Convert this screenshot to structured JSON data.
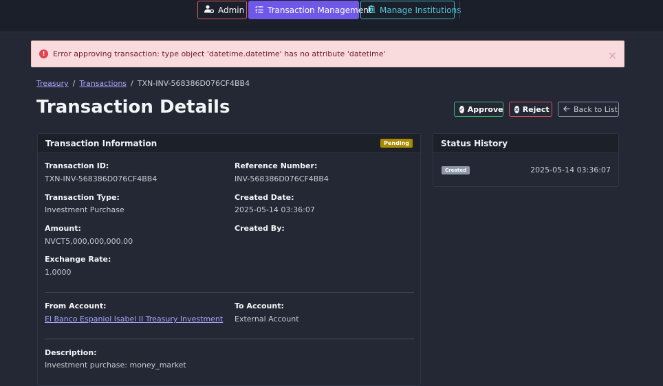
{
  "nav": {
    "admin_label": "Admin",
    "transaction_label": "Transaction Management",
    "institutions_label": "Manage Institutions"
  },
  "alert": {
    "message": "Error approving transaction: type object 'datetime.datetime' has no attribute 'datetime'",
    "icon": "exclamation-circle-icon",
    "close_glyph": "×"
  },
  "breadcrumb": {
    "items": [
      "Treasury",
      "Transactions",
      "TXN-INV-568386D076CF4BB4"
    ],
    "separator": "/"
  },
  "page": {
    "title": "Transaction Details"
  },
  "actions": {
    "approve_label": "Approve",
    "reject_label": "Reject",
    "back_label": "Back to List"
  },
  "info": {
    "header": "Transaction Information",
    "status_badge": "Pending",
    "transaction_id_label": "Transaction ID:",
    "transaction_id": "TXN-INV-568386D076CF4BB4",
    "reference_label": "Reference Number:",
    "reference": "INV-568386D076CF4BB4",
    "type_label": "Transaction Type:",
    "type": "Investment Purchase",
    "created_date_label": "Created Date:",
    "created_date": "2025-05-14 03:36:07",
    "amount_label": "Amount:",
    "amount": "NVCT5,000,000,000.00",
    "created_by_label": "Created By:",
    "created_by": "",
    "exchange_rate_label": "Exchange Rate:",
    "exchange_rate": "1.0000",
    "from_account_label": "From Account:",
    "from_account": "El Banco Espaniol Isabel II Treasury Investment",
    "to_account_label": "To Account:",
    "to_account": "External Account",
    "description_label": "Description:",
    "description": "Investment purchase: money_market"
  },
  "status_history": {
    "header": "Status History",
    "entries": [
      {
        "status": "Created",
        "time": "2025-05-14 03:36:07"
      }
    ]
  },
  "colors": {
    "background": "#232834",
    "topbar": "#1b1f29",
    "accent": "#6f58e8",
    "danger": "#e2525e",
    "success": "#3dbb72",
    "pending": "#a98a00",
    "link": "#a9a6ff"
  }
}
